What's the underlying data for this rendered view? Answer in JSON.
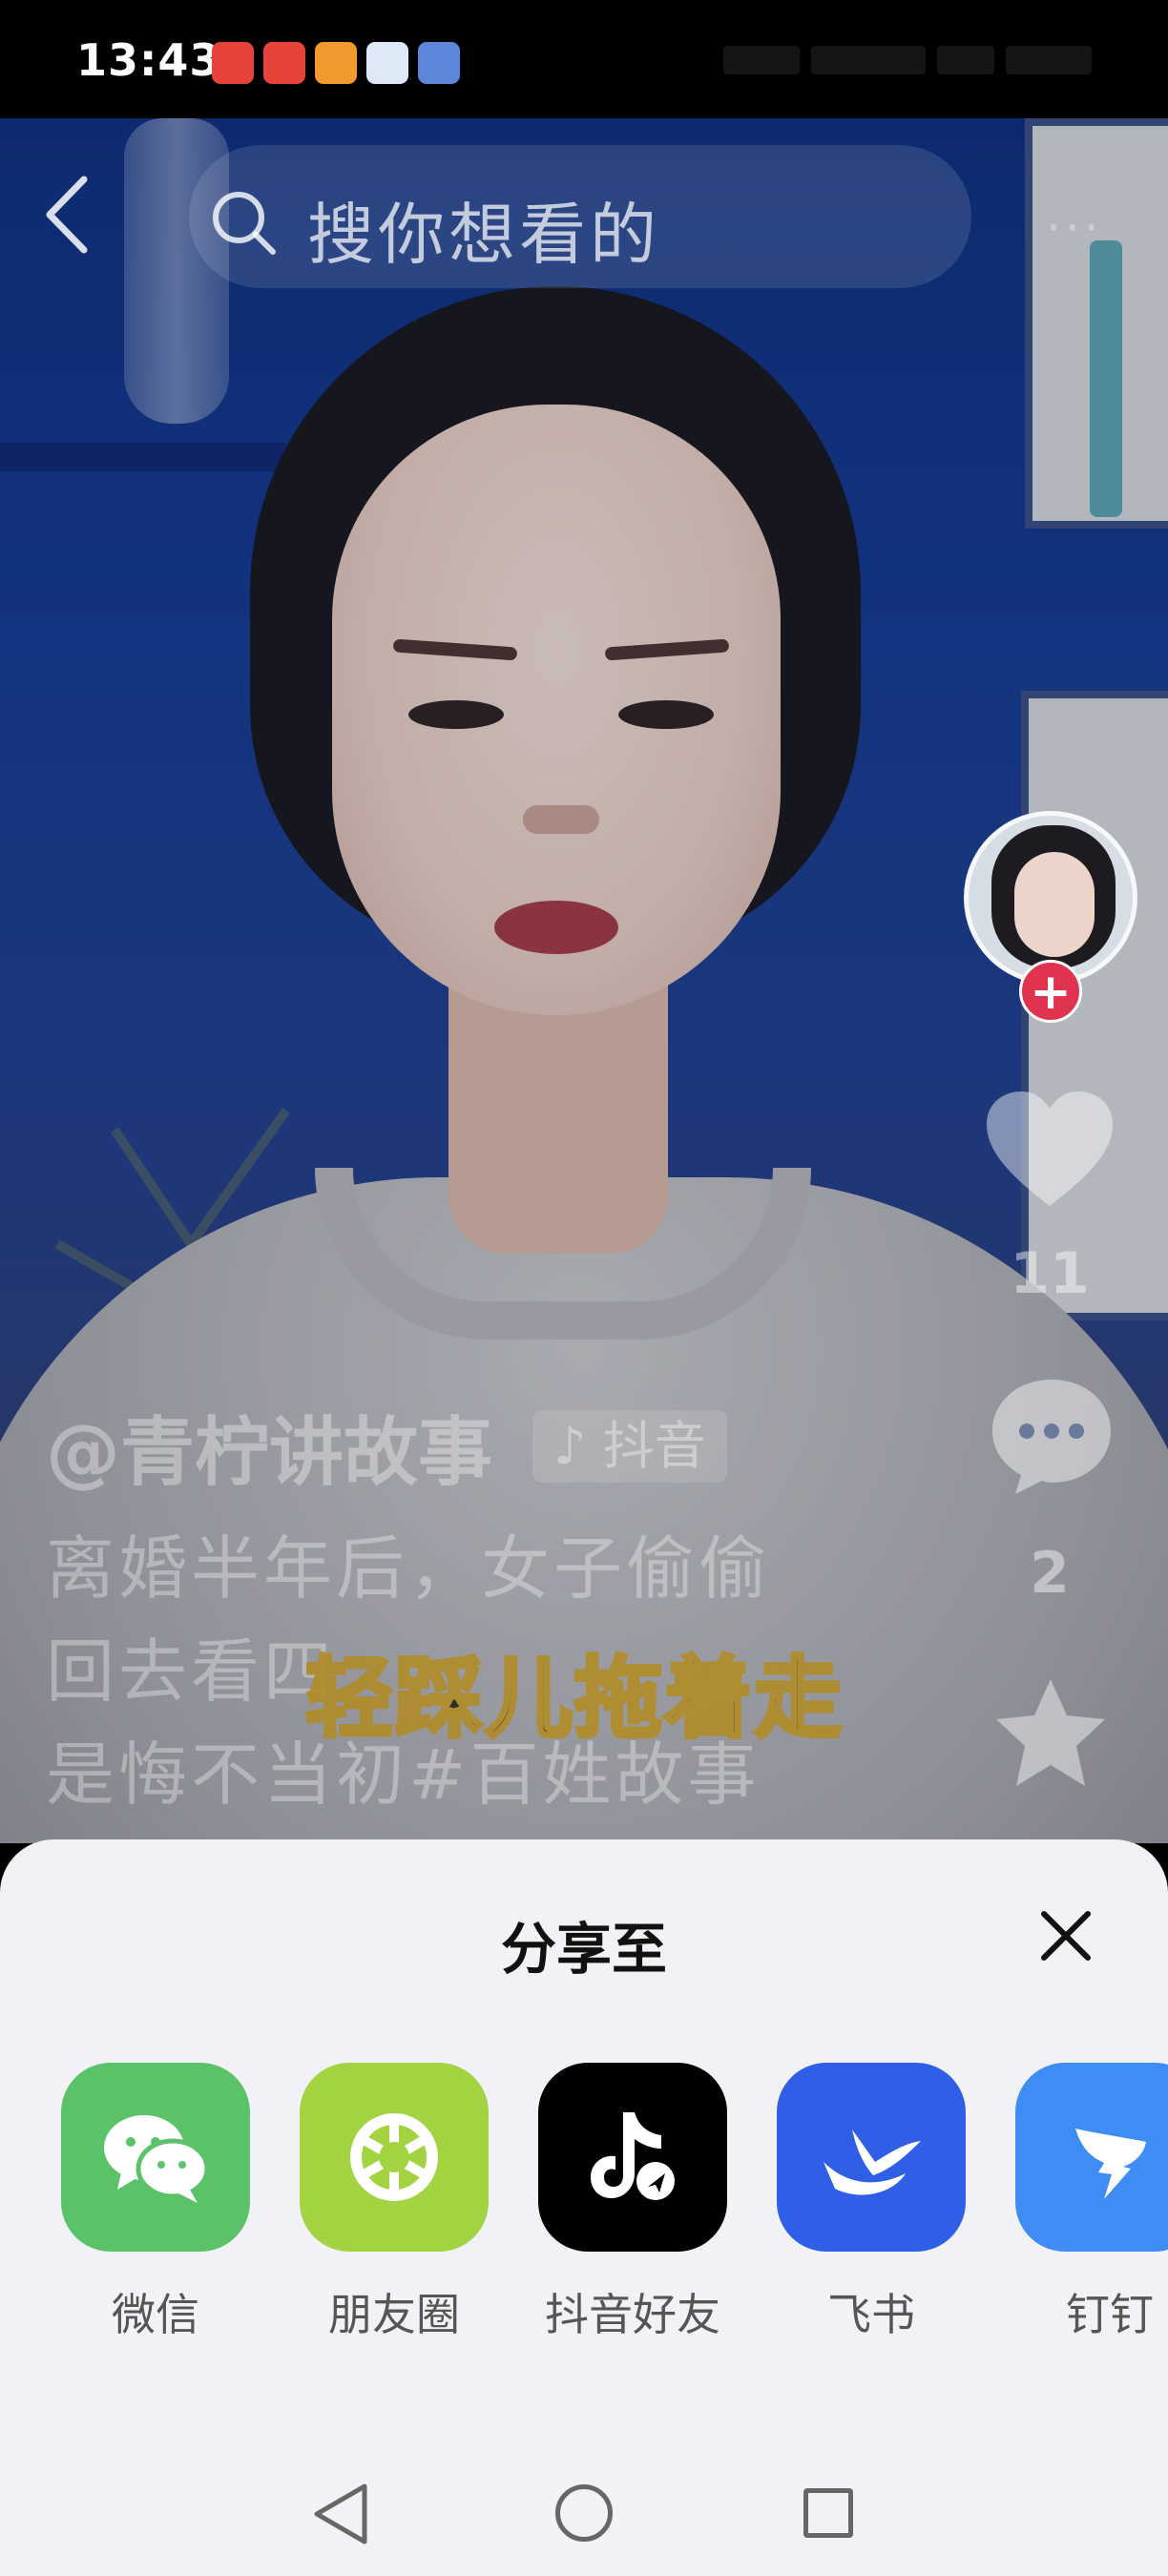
{
  "status_bar": {
    "time": "13:43",
    "notification_icons": [
      "app-icon-red-1",
      "app-icon-red-2",
      "app-icon-orange-heart",
      "app-icon-blue-1",
      "app-icon-blue-2"
    ]
  },
  "top_bar": {
    "search_placeholder": "搜你想看的",
    "more_label": "···"
  },
  "video": {
    "like_count": "11",
    "comment_count": "2",
    "author": "@青柠讲故事",
    "platform_tag": "♪ 抖音",
    "description_lines": [
      "离婚半年后，女子偷偷",
      "回去看四",
      "是悔不当初#百姓故事"
    ],
    "subtitle": "轻踩儿拖着走"
  },
  "share_sheet": {
    "title": "分享至",
    "apps": [
      {
        "label": "微信",
        "color": "#5cc269",
        "icon": "wechat-icon"
      },
      {
        "label": "朋友圈",
        "color": "#a3d341",
        "icon": "moments-icon"
      },
      {
        "label": "抖音好友",
        "color": "#000000",
        "icon": "douyin-icon"
      },
      {
        "label": "飞书",
        "color": "#2f5fe6",
        "icon": "feishu-icon"
      },
      {
        "label": "钉钉",
        "color": "#3f8cf4",
        "icon": "dingtalk-icon"
      }
    ]
  },
  "colors": {
    "follow_button": "#e0334f",
    "sheet_background": "#f1f2f5"
  }
}
